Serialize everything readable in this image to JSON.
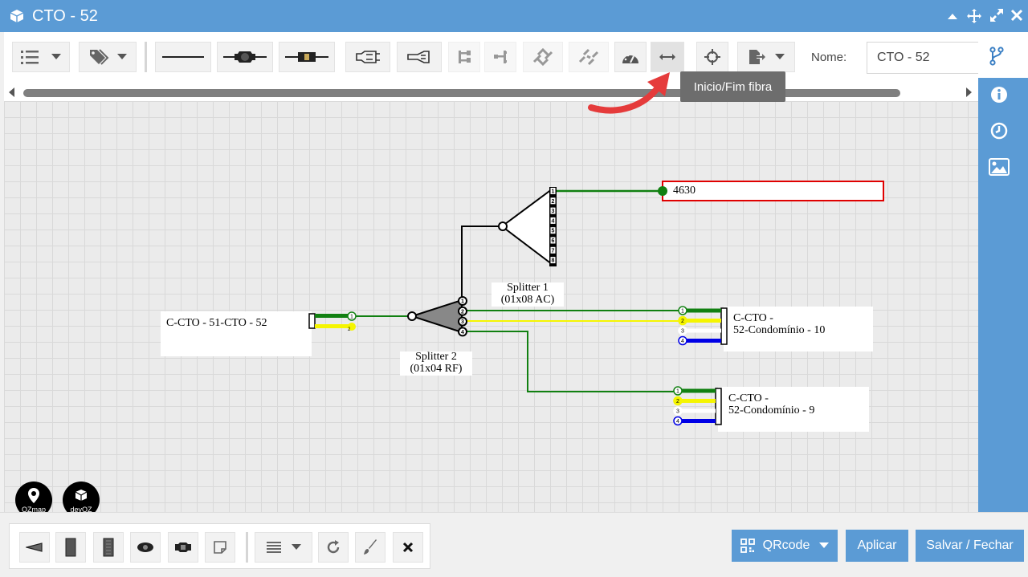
{
  "window": {
    "title": "CTO - 52"
  },
  "toolbar": {
    "nome_label": "Nome:",
    "nome_value": "CTO - 52"
  },
  "tooltip": "Inicio/Fim fibra",
  "diagram": {
    "output_box_label": "4630",
    "splitter1_name": "Splitter 1",
    "splitter1_spec": "(01x08 AC)",
    "splitter2_name": "Splitter 2",
    "splitter2_spec": "(01x04 RF)",
    "input_cable": "C-CTO - 51-CTO - 52",
    "cable_a_line1": "C-CTO -",
    "cable_a_line2": "52-Condomínio - 10",
    "cable_b_line1": "C-CTO -",
    "cable_b_line2": "52-Condomínio - 9",
    "port_numbers_8": [
      "1",
      "2",
      "3",
      "4",
      "5",
      "6",
      "7",
      "8"
    ],
    "port_numbers_4": [
      "1",
      "2",
      "3",
      "4"
    ],
    "fiber_colors": [
      "#118011",
      "#f5f500",
      "#ffffff",
      "#0000e6"
    ]
  },
  "logos": {
    "ozmap": "OZmap",
    "devoz": "devOZ"
  },
  "bottom": {
    "qrcode_label": "QRcode",
    "apply_label": "Aplicar",
    "save_close_label": "Salvar / Fechar"
  }
}
